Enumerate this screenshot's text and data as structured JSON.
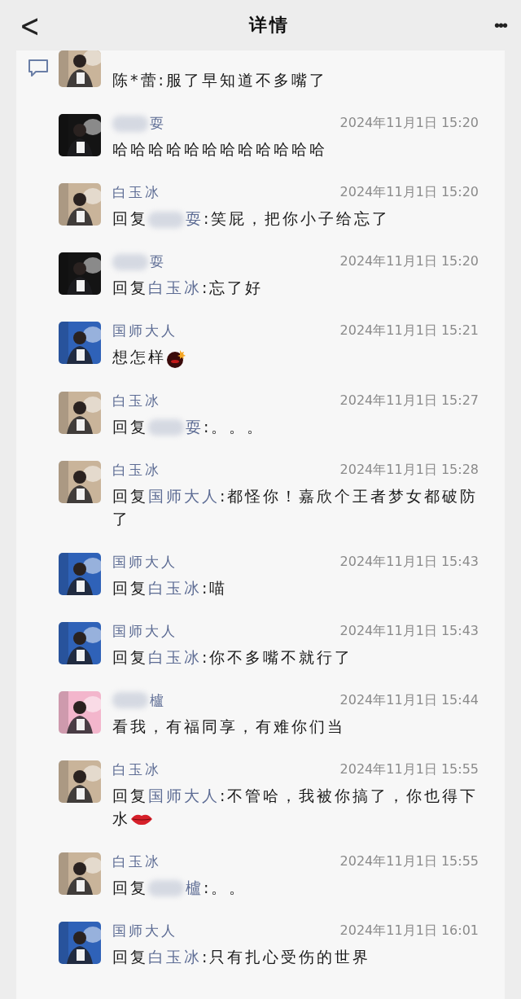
{
  "header": {
    "back": "<",
    "title": "详情",
    "more": "•••"
  },
  "comments": [
    {
      "clipped": true,
      "avatar": {
        "kind": "picture",
        "color": "#c9b49a"
      },
      "message": [
        {
          "kind": "text",
          "text": "陈*蕾:服了早知道不多嘴了"
        }
      ]
    },
    {
      "avatar": {
        "kind": "picture",
        "color": "#141414"
      },
      "name": [
        {
          "kind": "blur"
        },
        {
          "kind": "text",
          "text": "耍"
        }
      ],
      "time": "2024年11月1日 15:20",
      "message": [
        {
          "kind": "text",
          "text": "哈哈哈哈哈哈哈哈哈哈哈哈"
        }
      ]
    },
    {
      "avatar": {
        "kind": "picture",
        "color": "#c9b49a"
      },
      "name": [
        {
          "kind": "text",
          "text": "白玉冰"
        }
      ],
      "time": "2024年11月1日 15:20",
      "message": [
        {
          "kind": "text",
          "text": "回复"
        },
        {
          "kind": "blur"
        },
        {
          "kind": "mention",
          "text": "耍"
        },
        {
          "kind": "text",
          "text": ":笑屁，把你小子给忘了"
        }
      ]
    },
    {
      "avatar": {
        "kind": "picture",
        "color": "#141414"
      },
      "name": [
        {
          "kind": "blur"
        },
        {
          "kind": "text",
          "text": "耍"
        }
      ],
      "time": "2024年11月1日 15:20",
      "message": [
        {
          "kind": "text",
          "text": "回复"
        },
        {
          "kind": "mention",
          "text": "白玉冰"
        },
        {
          "kind": "text",
          "text": ":忘了好"
        }
      ]
    },
    {
      "avatar": {
        "kind": "picture",
        "color": "#2f62b8"
      },
      "name": [
        {
          "kind": "text",
          "text": "国师大人"
        }
      ],
      "time": "2024年11月1日 15:21",
      "message": [
        {
          "kind": "text",
          "text": "想怎样"
        },
        {
          "kind": "bomb"
        }
      ]
    },
    {
      "avatar": {
        "kind": "picture",
        "color": "#c9b49a"
      },
      "name": [
        {
          "kind": "text",
          "text": "白玉冰"
        }
      ],
      "time": "2024年11月1日 15:27",
      "message": [
        {
          "kind": "text",
          "text": "回复"
        },
        {
          "kind": "blur"
        },
        {
          "kind": "mention",
          "text": "耍"
        },
        {
          "kind": "text",
          "text": ":。。。"
        }
      ]
    },
    {
      "avatar": {
        "kind": "picture",
        "color": "#c9b49a"
      },
      "name": [
        {
          "kind": "text",
          "text": "白玉冰"
        }
      ],
      "time": "2024年11月1日 15:28",
      "message": [
        {
          "kind": "text",
          "text": "回复"
        },
        {
          "kind": "mention",
          "text": "国师大人"
        },
        {
          "kind": "text",
          "text": ":都怪你！嘉欣个王者梦女都破防了"
        }
      ]
    },
    {
      "avatar": {
        "kind": "picture",
        "color": "#2f62b8"
      },
      "name": [
        {
          "kind": "text",
          "text": "国师大人"
        }
      ],
      "time": "2024年11月1日 15:43",
      "message": [
        {
          "kind": "text",
          "text": "回复"
        },
        {
          "kind": "mention",
          "text": "白玉冰"
        },
        {
          "kind": "text",
          "text": ":喵"
        }
      ]
    },
    {
      "avatar": {
        "kind": "picture",
        "color": "#2f62b8"
      },
      "name": [
        {
          "kind": "text",
          "text": "国师大人"
        }
      ],
      "time": "2024年11月1日 15:43",
      "message": [
        {
          "kind": "text",
          "text": "回复"
        },
        {
          "kind": "mention",
          "text": "白玉冰"
        },
        {
          "kind": "text",
          "text": ":你不多嘴不就行了"
        }
      ]
    },
    {
      "avatar": {
        "kind": "picture",
        "color": "#f3b6cc"
      },
      "name": [
        {
          "kind": "blur"
        },
        {
          "kind": "text",
          "text": "櫨"
        }
      ],
      "time": "2024年11月1日 15:44",
      "message": [
        {
          "kind": "text",
          "text": "看我，有福同享，有难你们当"
        }
      ]
    },
    {
      "avatar": {
        "kind": "picture",
        "color": "#c9b49a"
      },
      "name": [
        {
          "kind": "text",
          "text": "白玉冰"
        }
      ],
      "time": "2024年11月1日 15:55",
      "message": [
        {
          "kind": "text",
          "text": "回复"
        },
        {
          "kind": "mention",
          "text": "国师大人"
        },
        {
          "kind": "text",
          "text": ":不管哈，我被你搞了，你也得下水"
        },
        {
          "kind": "lips"
        }
      ]
    },
    {
      "avatar": {
        "kind": "picture",
        "color": "#c9b49a"
      },
      "name": [
        {
          "kind": "text",
          "text": "白玉冰"
        }
      ],
      "time": "2024年11月1日 15:55",
      "message": [
        {
          "kind": "text",
          "text": "回复"
        },
        {
          "kind": "blur"
        },
        {
          "kind": "mention",
          "text": "櫨"
        },
        {
          "kind": "text",
          "text": ":。。"
        }
      ]
    },
    {
      "avatar": {
        "kind": "picture",
        "color": "#2f62b8"
      },
      "name": [
        {
          "kind": "text",
          "text": "国师大人"
        }
      ],
      "time": "2024年11月1日 16:01",
      "message": [
        {
          "kind": "text",
          "text": "回复"
        },
        {
          "kind": "mention",
          "text": "白玉冰"
        },
        {
          "kind": "text",
          "text": ":只有扎心受伤的世界"
        }
      ]
    }
  ]
}
